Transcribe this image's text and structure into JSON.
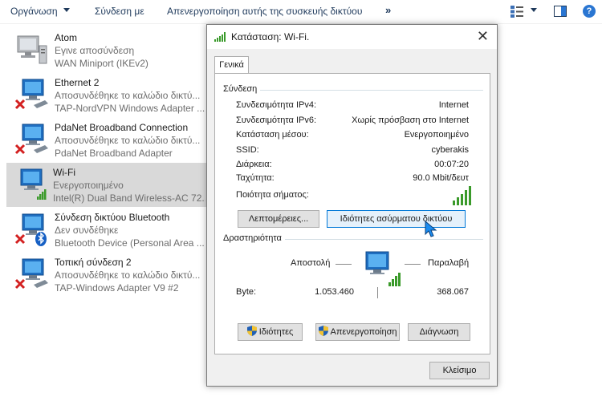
{
  "toolbar": {
    "organize": "Οργάνωση",
    "connect_to": "Σύνδεση με",
    "disable_device": "Απενεργοποίηση αυτής της συσκευής δικτύου",
    "more": "»"
  },
  "connections": [
    {
      "name": "Atom",
      "status": "Εγινε αποσύνδεση",
      "adapter": "WAN Miniport (IKEv2)",
      "icon": "wan-computer-icon"
    },
    {
      "name": "Ethernet 2",
      "status": "Αποσυνδέθηκε το καλώδιο δικτύ...",
      "adapter": "TAP-NordVPN Windows Adapter ...",
      "icon": "ethernet-disconnected-icon"
    },
    {
      "name": "PdaNet Broadband Connection",
      "status": "Αποσυνδέθηκε το καλώδιο δικτύ...",
      "adapter": "PdaNet Broadband Adapter",
      "icon": "ethernet-disconnected-icon"
    },
    {
      "name": "Wi-Fi",
      "status": "Ενεργοποιημένο",
      "adapter": "Intel(R) Dual Band Wireless-AC 72...",
      "icon": "wifi-connected-icon"
    },
    {
      "name": "Σύνδεση δικτύου Bluetooth",
      "status": "Δεν συνδέθηκε",
      "adapter": "Bluetooth Device (Personal Area ...",
      "icon": "bluetooth-disconnected-icon"
    },
    {
      "name": "Τοπική σύνδεση 2",
      "status": "Αποσυνδέθηκε το καλώδιο δικτύ...",
      "adapter": "TAP-Windows Adapter V9 #2",
      "icon": "ethernet-disconnected-icon"
    }
  ],
  "dialog": {
    "title": "Κατάσταση: Wi-Fi.",
    "close": "✕",
    "tab_general": "Γενικά",
    "connection_group": "Σύνδεση",
    "rows": [
      {
        "label": "Συνδεσιμότητα IPv4:",
        "value": "Internet"
      },
      {
        "label": "Συνδεσιμότητα IPv6:",
        "value": "Χωρίς πρόσβαση στο Internet"
      },
      {
        "label": "Κατάσταση μέσου:",
        "value": "Ενεργοποιημένο"
      },
      {
        "label": "SSID:",
        "value": "cyberakis"
      },
      {
        "label": "Διάρκεια:",
        "value": "00:07:20"
      },
      {
        "label": "Ταχύτητα:",
        "value": "90.0 Mbit/δευτ"
      }
    ],
    "signal_label": "Ποιότητα σήματος:",
    "signal_bars": 5,
    "details_button": "Λεπτομέρειες...",
    "wireless_props_button": "Ιδιότητες ασύρματου δικτύου",
    "activity_group": "Δραστηριότητα",
    "sent_label": "Αποστολή",
    "received_label": "Παραλαβή",
    "bytes_label": "Byte:",
    "bytes_sent": "1.053.460",
    "bytes_received": "368.067",
    "properties_button": "Ιδιότητες",
    "disable_button": "Απενεργοποίηση",
    "diagnose_button": "Διάγνωση",
    "close_button": "Κλείσιμο"
  },
  "colors": {
    "accent": "#0078d7",
    "signal_green": "#3a9a2a",
    "error_red": "#d32020",
    "selection": "#d9d9d9"
  }
}
